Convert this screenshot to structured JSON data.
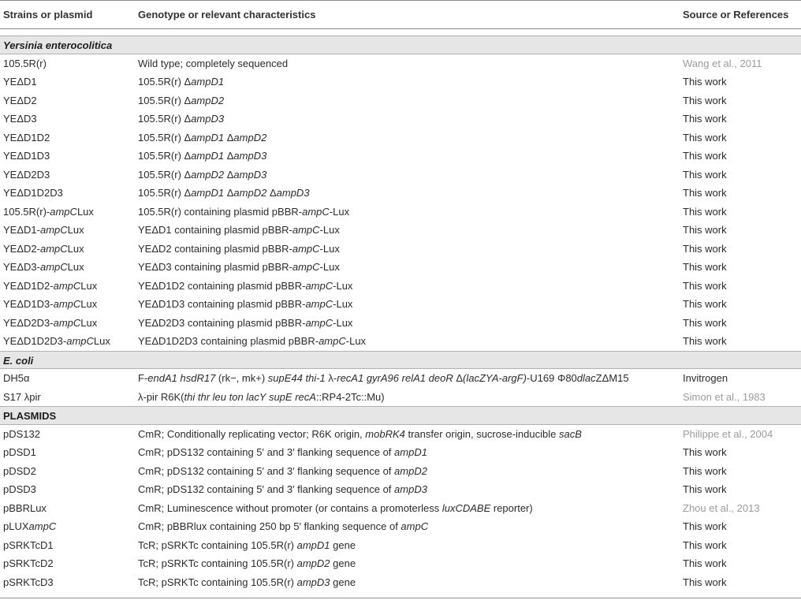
{
  "headers": {
    "strains": "Strains or plasmid",
    "genotype": "Genotype or relevant characteristics",
    "source": "Source or References"
  },
  "sections": [
    {
      "title": "Yersinia enterocolitica",
      "italic": true,
      "rows": [
        {
          "strain": "105.5R(r)",
          "genotype": "Wild type; completely sequenced",
          "source": "Wang et al., 2011",
          "source_link": true
        },
        {
          "strain": "YEΔD1",
          "genotype": "105.5R(r) ΔampD1",
          "source": "This work"
        },
        {
          "strain": "YEΔD2",
          "genotype": "105.5R(r) ΔampD2",
          "source": "This work"
        },
        {
          "strain": "YEΔD3",
          "genotype": "105.5R(r) ΔampD3",
          "source": "This work"
        },
        {
          "strain": "YEΔD1D2",
          "genotype": "105.5R(r) ΔampD1 ΔampD2",
          "source": "This work"
        },
        {
          "strain": "YEΔD1D3",
          "genotype": "105.5R(r) ΔampD1 ΔampD3",
          "source": "This work"
        },
        {
          "strain": "YEΔD2D3",
          "genotype": "105.5R(r) ΔampD2 ΔampD3",
          "source": "This work"
        },
        {
          "strain": "YEΔD1D2D3",
          "genotype": "105.5R(r) ΔampD1 ΔampD2 ΔampD3",
          "source": "This work"
        },
        {
          "strain": "105.5R(r)-ampCLux",
          "genotype": "105.5R(r) containing plasmid pBBR-ampC-Lux",
          "source": "This work"
        },
        {
          "strain": "YEΔD1-ampCLux",
          "genotype": "YEΔD1 containing plasmid pBBR-ampC-Lux",
          "source": "This work"
        },
        {
          "strain": "YEΔD2-ampCLux",
          "genotype": "YEΔD2 containing plasmid pBBR-ampC-Lux",
          "source": "This work"
        },
        {
          "strain": "YEΔD3-ampCLux",
          "genotype": "YEΔD3 containing plasmid pBBR-ampC-Lux",
          "source": "This work"
        },
        {
          "strain": "YEΔD1D2-ampCLux",
          "genotype": "YEΔD1D2 containing plasmid pBBR-ampC-Lux",
          "source": "This work"
        },
        {
          "strain": "YEΔD1D3-ampCLux",
          "genotype": "YEΔD1D3 containing plasmid pBBR-ampC-Lux",
          "source": "This work"
        },
        {
          "strain": "YEΔD2D3-ampCLux",
          "genotype": "YEΔD2D3 containing plasmid pBBR-ampC-Lux",
          "source": "This work"
        },
        {
          "strain": "YEΔD1D2D3-ampCLux",
          "genotype": "YEΔD1D2D3 containing plasmid pBBR-ampC-Lux",
          "source": "This work"
        }
      ]
    },
    {
      "title": "E. coli",
      "italic": true,
      "rows": [
        {
          "strain": "DH5α",
          "genotype": "F-endA1 hsdR17 (rk−, mk+) supE44 thi-1 λ-recA1 gyrA96 relA1 deoR Δ(lacZYA-argF)-U169 Φ80dlacZΔM15",
          "source": "Invitrogen"
        },
        {
          "strain": "S17 λpir",
          "genotype": "λ-pir R6K(thi thr leu ton lacY supE recA::RP4-2Tc::Mu)",
          "source": "Simon et al., 1983",
          "source_link": true
        }
      ]
    },
    {
      "title": "PLASMIDS",
      "italic": false,
      "rows": [
        {
          "strain": "pDS132",
          "genotype": "CmR; Conditionally replicating vector; R6K origin, mobRK4 transfer origin, sucrose-inducible sacB",
          "source": "Philippe et al., 2004",
          "source_link": true
        },
        {
          "strain": "pDSD1",
          "genotype": "CmR; pDS132 containing 5′ and 3′ flanking sequence of ampD1",
          "source": "This work"
        },
        {
          "strain": "pDSD2",
          "genotype": "CmR; pDS132 containing 5′ and 3′ flanking sequence of ampD2",
          "source": "This work"
        },
        {
          "strain": "pDSD3",
          "genotype": "CmR; pDS132 containing 5′ and 3′ flanking sequence of ampD3",
          "source": "This work"
        },
        {
          "strain": "pBBRLux",
          "genotype": "CmR; Luminescence without promoter (or contains a promoterless luxCDABE reporter)",
          "source": "Zhou et al., 2013",
          "source_link": true
        },
        {
          "strain": "pLUXampC",
          "genotype": "CmR; pBBRlux containing 250 bp 5′ flanking sequence of ampC",
          "source": "This work"
        },
        {
          "strain": "pSRKTcD1",
          "genotype": "TcR; pSRKTc containing 105.5R(r) ampD1 gene",
          "source": "This work"
        },
        {
          "strain": "pSRKTcD2",
          "genotype": "TcR; pSRKTc containing 105.5R(r) ampD2 gene",
          "source": "This work"
        },
        {
          "strain": "pSRKTcD3",
          "genotype": "TcR; pSRKTc containing 105.5R(r) ampD3 gene",
          "source": "This work"
        }
      ]
    }
  ]
}
